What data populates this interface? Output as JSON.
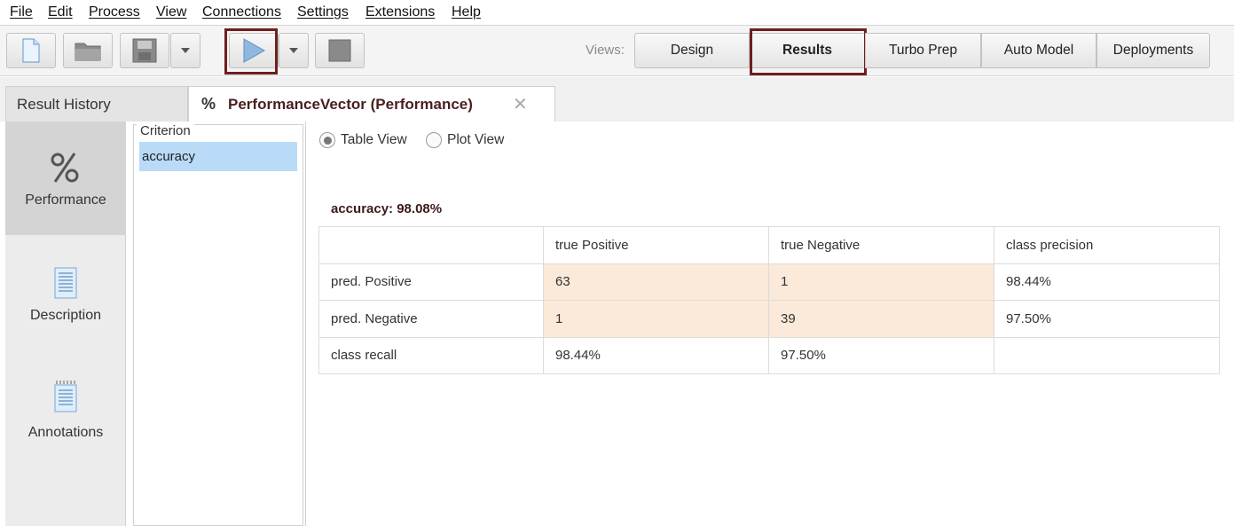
{
  "menu": [
    "File",
    "Edit",
    "Process",
    "View",
    "Connections",
    "Settings",
    "Extensions",
    "Help"
  ],
  "toolbar": {
    "icons": [
      "new-process-icon",
      "open-folder-icon",
      "save-icon",
      "run-icon",
      "stop-icon"
    ],
    "views_label": "Views:",
    "views": [
      "Design",
      "Results",
      "Turbo Prep",
      "Auto Model",
      "Deployments"
    ],
    "active_view": "Results"
  },
  "tabs": {
    "history": "Result History",
    "performance": "PerformanceVector (Performance)",
    "performance_icon": "%"
  },
  "left_panel": {
    "items": [
      {
        "label": "Performance",
        "icon": "percent-icon"
      },
      {
        "label": "Description",
        "icon": "document-icon"
      },
      {
        "label": "Annotations",
        "icon": "notes-icon"
      }
    ]
  },
  "criterion": {
    "legend": "Criterion",
    "items": [
      "accuracy"
    ]
  },
  "view_mode": {
    "table": "Table View",
    "plot": "Plot View",
    "selected": "Table View"
  },
  "performance": {
    "title": "accuracy: 98.08%",
    "headers": [
      "",
      "true Positive",
      "true Negative",
      "class precision"
    ],
    "rows": [
      [
        "pred. Positive",
        "63",
        "1",
        "98.44%"
      ],
      [
        "pred. Negative",
        "1",
        "39",
        "97.50%"
      ],
      [
        "class recall",
        "98.44%",
        "97.50%",
        ""
      ]
    ]
  },
  "colors": {
    "highlight_border": "#6e1f1f",
    "cell_highlight": "#fbe9d9",
    "selected_criterion": "#b9dbf7"
  }
}
